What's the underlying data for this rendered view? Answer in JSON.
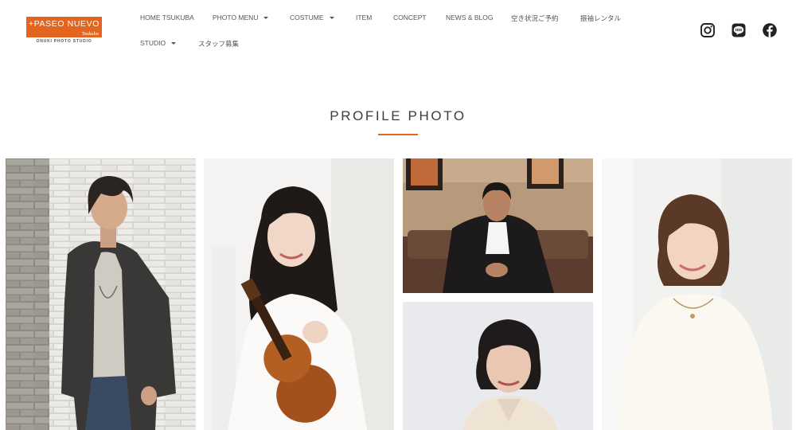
{
  "brand": {
    "logo_main": "+PASEO NUEVO",
    "logo_script": "Tsukuba",
    "logo_sub": "ONUKI PHOTO STUDIO"
  },
  "nav": {
    "row1": [
      {
        "label": "HOME TSUKUBA",
        "dropdown": false
      },
      {
        "label": "PHOTO MENU",
        "dropdown": true
      },
      {
        "label": "COSTUME",
        "dropdown": true
      },
      {
        "label": "ITEM",
        "dropdown": false
      },
      {
        "label": "CONCEPT",
        "dropdown": false
      },
      {
        "label": "NEWS & BLOG",
        "dropdown": false
      },
      {
        "label": "空き状況ご予約",
        "dropdown": false
      },
      {
        "label": "振袖レンタル",
        "dropdown": false
      }
    ],
    "row2": [
      {
        "label": "STUDIO",
        "dropdown": true
      },
      {
        "label": "スタッフ募集",
        "dropdown": false
      }
    ]
  },
  "social": {
    "icons": [
      "instagram-icon",
      "line-icon",
      "facebook-icon"
    ]
  },
  "section": {
    "title": "PROFILE PHOTO"
  },
  "gallery": {
    "photos": [
      {
        "subject": "man-with-jacket-brick-wall"
      },
      {
        "subject": "woman-with-violin"
      },
      {
        "subject": "man-on-sofa"
      },
      {
        "subject": "woman-portrait-grey-backdrop"
      },
      {
        "subject": "woman-in-white-blouse"
      }
    ]
  },
  "colors": {
    "accent": "#e4651f",
    "text": "#555555",
    "title": "#3c3c3c"
  }
}
